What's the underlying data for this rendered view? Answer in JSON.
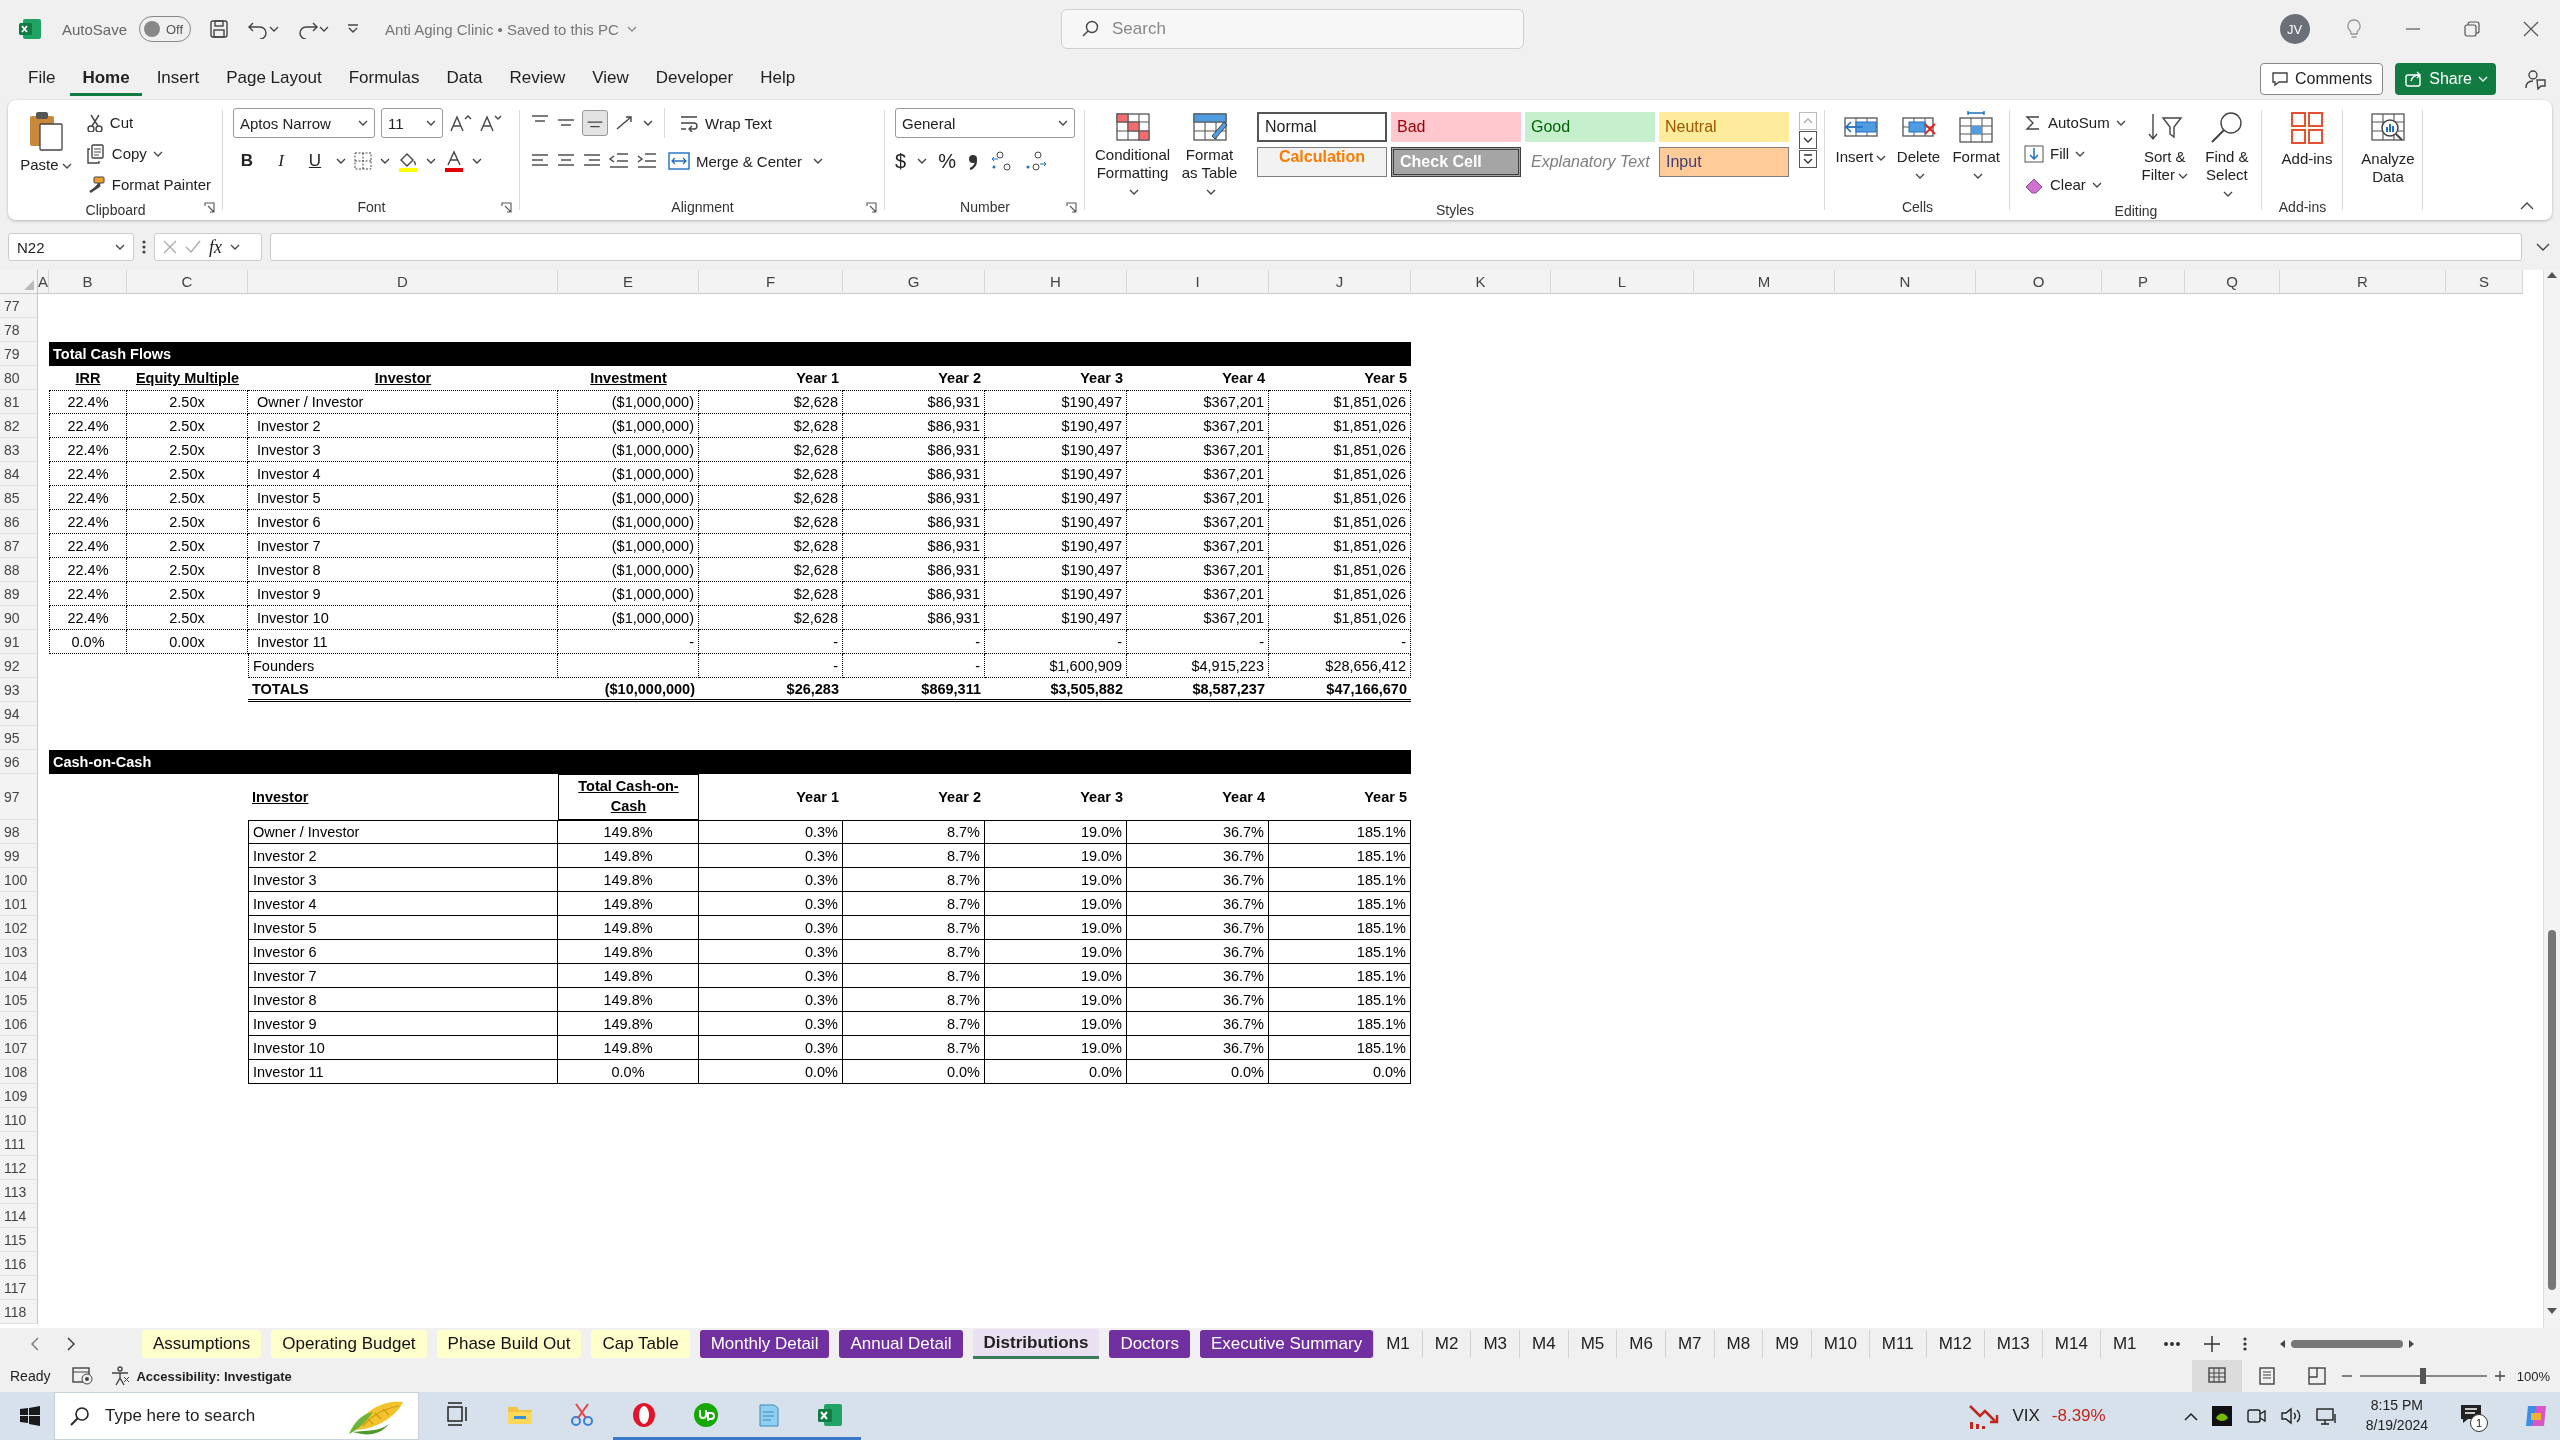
{
  "title_bar": {
    "autosave_label": "AutoSave",
    "autosave": {
      "on": false,
      "label": "Off"
    },
    "document_title": "Anti Aging Clinic • Saved to this PC",
    "search_placeholder": "Search",
    "avatar": "JV"
  },
  "menu": [
    {
      "label": "File",
      "selected": false
    },
    {
      "label": "Home",
      "selected": true
    },
    {
      "label": "Insert",
      "selected": false
    },
    {
      "label": "Page Layout",
      "selected": false
    },
    {
      "label": "Formulas",
      "selected": false
    },
    {
      "label": "Data",
      "selected": false
    },
    {
      "label": "Review",
      "selected": false
    },
    {
      "label": "View",
      "selected": false
    },
    {
      "label": "Developer",
      "selected": false
    },
    {
      "label": "Help",
      "selected": false
    }
  ],
  "comments_button": "Comments",
  "share_button": "Share",
  "ribbon": [
    {
      "kind": "clipboard",
      "label": "Clipboard",
      "paste": "Paste",
      "commands": [
        "Cut",
        "Copy",
        "Format Painter"
      ]
    },
    {
      "kind": "font",
      "label": "Font",
      "font": "Aptos Narrow",
      "size": "11",
      "styles": [
        "B",
        "I",
        "U"
      ]
    },
    {
      "kind": "alignment",
      "label": "Alignment",
      "commands": [
        "Wrap Text",
        "Merge & Center"
      ]
    },
    {
      "kind": "number",
      "label": "Number",
      "format": "General",
      "symbols": [
        "$",
        "%"
      ]
    },
    {
      "kind": "styles",
      "label": "Styles",
      "commands": [
        "Conditional Formatting",
        "Format as Table"
      ],
      "gallery": [
        {
          "label": "Normal",
          "kind": "normal"
        },
        {
          "label": "Bad",
          "kind": "bad"
        },
        {
          "label": "Good",
          "kind": "good"
        },
        {
          "label": "Neutral",
          "kind": "neutral"
        },
        {
          "label": "Calculation",
          "kind": "calculation"
        },
        {
          "label": "Check Cell",
          "kind": "check"
        },
        {
          "label": "Explanatory Text",
          "kind": "explanatory"
        },
        {
          "label": "Input",
          "kind": "input"
        }
      ]
    },
    {
      "kind": "cells",
      "label": "Cells",
      "commands": [
        "Insert",
        "Delete",
        "Format"
      ]
    },
    {
      "kind": "editing",
      "label": "Editing",
      "commands": [
        "AutoSum",
        "Fill",
        "Clear"
      ],
      "large": [
        "Sort & Filter",
        "Find & Select"
      ]
    },
    {
      "kind": "addins",
      "label": "Add-ins",
      "commands": [
        "Add-ins"
      ]
    },
    {
      "kind": "analyze",
      "commands": [
        "Analyze Data"
      ]
    }
  ],
  "formula_bar": {
    "name_box": "N22",
    "fx": "fx"
  },
  "sheet": {
    "columns": [
      "A",
      "B",
      "C",
      "D",
      "E",
      "F",
      "G",
      "H",
      "I",
      "J",
      "K",
      "L",
      "M",
      "N",
      "O",
      "P",
      "Q",
      "R",
      "S"
    ],
    "rows": [
      {
        "number": "77",
        "kind": "empty"
      },
      {
        "number": "78",
        "kind": "empty"
      },
      {
        "number": "79",
        "kind": "banner",
        "cells": {
          "B": "Total Cash Flows"
        }
      },
      {
        "number": "80",
        "kind": "header",
        "cells": {
          "B": {
            "text": "IRR",
            "underlined": true
          },
          "C": {
            "text": "Equity Multiple",
            "underlined": true
          },
          "D": {
            "text": "Investor",
            "underlined": true
          },
          "E": {
            "text": "Investment",
            "underlined": true
          },
          "F": {
            "text": "Year 1",
            "underlined": false
          },
          "G": {
            "text": "Year 2",
            "underlined": false
          },
          "H": {
            "text": "Year 3",
            "underlined": false
          },
          "I": {
            "text": "Year 4",
            "underlined": false
          },
          "J": {
            "text": "Year 5",
            "underlined": false
          }
        }
      },
      {
        "number": "81",
        "kind": "data",
        "cells": {
          "B": "22.4%",
          "C": "2.50x",
          "D": "Owner / Investor",
          "E": "($1,000,000)",
          "F": "$2,628",
          "G": "$86,931",
          "H": "$190,497",
          "I": "$367,201",
          "J": "$1,851,026"
        }
      },
      {
        "number": "82",
        "kind": "data",
        "cells": {
          "B": "22.4%",
          "C": "2.50x",
          "D": "Investor 2",
          "E": "($1,000,000)",
          "F": "$2,628",
          "G": "$86,931",
          "H": "$190,497",
          "I": "$367,201",
          "J": "$1,851,026"
        }
      },
      {
        "number": "83",
        "kind": "data",
        "cells": {
          "B": "22.4%",
          "C": "2.50x",
          "D": "Investor 3",
          "E": "($1,000,000)",
          "F": "$2,628",
          "G": "$86,931",
          "H": "$190,497",
          "I": "$367,201",
          "J": "$1,851,026"
        }
      },
      {
        "number": "84",
        "kind": "data",
        "cells": {
          "B": "22.4%",
          "C": "2.50x",
          "D": "Investor 4",
          "E": "($1,000,000)",
          "F": "$2,628",
          "G": "$86,931",
          "H": "$190,497",
          "I": "$367,201",
          "J": "$1,851,026"
        }
      },
      {
        "number": "85",
        "kind": "data",
        "cells": {
          "B": "22.4%",
          "C": "2.50x",
          "D": "Investor 5",
          "E": "($1,000,000)",
          "F": "$2,628",
          "G": "$86,931",
          "H": "$190,497",
          "I": "$367,201",
          "J": "$1,851,026"
        }
      },
      {
        "number": "86",
        "kind": "data",
        "cells": {
          "B": "22.4%",
          "C": "2.50x",
          "D": "Investor 6",
          "E": "($1,000,000)",
          "F": "$2,628",
          "G": "$86,931",
          "H": "$190,497",
          "I": "$367,201",
          "J": "$1,851,026"
        }
      },
      {
        "number": "87",
        "kind": "data",
        "cells": {
          "B": "22.4%",
          "C": "2.50x",
          "D": "Investor 7",
          "E": "($1,000,000)",
          "F": "$2,628",
          "G": "$86,931",
          "H": "$190,497",
          "I": "$367,201",
          "J": "$1,851,026"
        }
      },
      {
        "number": "88",
        "kind": "data",
        "cells": {
          "B": "22.4%",
          "C": "2.50x",
          "D": "Investor 8",
          "E": "($1,000,000)",
          "F": "$2,628",
          "G": "$86,931",
          "H": "$190,497",
          "I": "$367,201",
          "J": "$1,851,026"
        }
      },
      {
        "number": "89",
        "kind": "data",
        "cells": {
          "B": "22.4%",
          "C": "2.50x",
          "D": "Investor 9",
          "E": "($1,000,000)",
          "F": "$2,628",
          "G": "$86,931",
          "H": "$190,497",
          "I": "$367,201",
          "J": "$1,851,026"
        }
      },
      {
        "number": "90",
        "kind": "data",
        "cells": {
          "B": "22.4%",
          "C": "2.50x",
          "D": "Investor 10",
          "E": "($1,000,000)",
          "F": "$2,628",
          "G": "$86,931",
          "H": "$190,497",
          "I": "$367,201",
          "J": "$1,851,026"
        }
      },
      {
        "number": "91",
        "kind": "data",
        "cells": {
          "B": "0.0%",
          "C": "0.00x",
          "D": "Investor 11",
          "E": "-",
          "F": "-",
          "G": "-",
          "H": "-",
          "I": "-",
          "J": "-"
        }
      },
      {
        "number": "92",
        "kind": "subtotal",
        "cells": {
          "D": "Founders",
          "F": "-",
          "G": "-",
          "H": "$1,600,909",
          "I": "$4,915,223",
          "J": "$28,656,412"
        }
      },
      {
        "number": "93",
        "kind": "total",
        "cells": {
          "D": "TOTALS",
          "E": "($10,000,000)",
          "F": "$26,283",
          "G": "$869,311",
          "H": "$3,505,882",
          "I": "$8,587,237",
          "J": "$47,166,670"
        }
      },
      {
        "number": "94",
        "kind": "empty"
      },
      {
        "number": "95",
        "kind": "empty"
      },
      {
        "number": "96",
        "kind": "banner",
        "cells": {
          "B": "Cash-on-Cash"
        }
      },
      {
        "number": "97",
        "kind": "header-wrap",
        "cells": {
          "D": {
            "text": "Investor",
            "underlined": true
          },
          "E": {
            "text": "Total Cash-on-Cash",
            "underlined": true
          },
          "F": {
            "text": "Year 1",
            "underlined": false
          },
          "G": {
            "text": "Year 2",
            "underlined": false
          },
          "H": {
            "text": "Year 3",
            "underlined": false
          },
          "I": {
            "text": "Year 4",
            "underlined": false
          },
          "J": {
            "text": "Year 5",
            "underlined": false
          }
        }
      },
      {
        "number": "98",
        "kind": "ratio",
        "cells": {
          "D": "Owner / Investor",
          "E": "149.8%",
          "F": "0.3%",
          "G": "8.7%",
          "H": "19.0%",
          "I": "36.7%",
          "J": "185.1%"
        }
      },
      {
        "number": "99",
        "kind": "ratio",
        "cells": {
          "D": "Investor 2",
          "E": "149.8%",
          "F": "0.3%",
          "G": "8.7%",
          "H": "19.0%",
          "I": "36.7%",
          "J": "185.1%"
        }
      },
      {
        "number": "100",
        "kind": "ratio",
        "cells": {
          "D": "Investor 3",
          "E": "149.8%",
          "F": "0.3%",
          "G": "8.7%",
          "H": "19.0%",
          "I": "36.7%",
          "J": "185.1%"
        }
      },
      {
        "number": "101",
        "kind": "ratio",
        "cells": {
          "D": "Investor 4",
          "E": "149.8%",
          "F": "0.3%",
          "G": "8.7%",
          "H": "19.0%",
          "I": "36.7%",
          "J": "185.1%"
        }
      },
      {
        "number": "102",
        "kind": "ratio",
        "cells": {
          "D": "Investor 5",
          "E": "149.8%",
          "F": "0.3%",
          "G": "8.7%",
          "H": "19.0%",
          "I": "36.7%",
          "J": "185.1%"
        }
      },
      {
        "number": "103",
        "kind": "ratio",
        "cells": {
          "D": "Investor 6",
          "E": "149.8%",
          "F": "0.3%",
          "G": "8.7%",
          "H": "19.0%",
          "I": "36.7%",
          "J": "185.1%"
        }
      },
      {
        "number": "104",
        "kind": "ratio",
        "cells": {
          "D": "Investor 7",
          "E": "149.8%",
          "F": "0.3%",
          "G": "8.7%",
          "H": "19.0%",
          "I": "36.7%",
          "J": "185.1%"
        }
      },
      {
        "number": "105",
        "kind": "ratio",
        "cells": {
          "D": "Investor 8",
          "E": "149.8%",
          "F": "0.3%",
          "G": "8.7%",
          "H": "19.0%",
          "I": "36.7%",
          "J": "185.1%"
        }
      },
      {
        "number": "106",
        "kind": "ratio",
        "cells": {
          "D": "Investor 9",
          "E": "149.8%",
          "F": "0.3%",
          "G": "8.7%",
          "H": "19.0%",
          "I": "36.7%",
          "J": "185.1%"
        }
      },
      {
        "number": "107",
        "kind": "ratio",
        "cells": {
          "D": "Investor 10",
          "E": "149.8%",
          "F": "0.3%",
          "G": "8.7%",
          "H": "19.0%",
          "I": "36.7%",
          "J": "185.1%"
        }
      },
      {
        "number": "108",
        "kind": "ratio",
        "cells": {
          "D": "Investor 11",
          "E": "0.0%",
          "F": "0.0%",
          "G": "0.0%",
          "H": "0.0%",
          "I": "0.0%",
          "J": "0.0%"
        }
      },
      {
        "number": "109",
        "kind": "empty"
      },
      {
        "number": "110",
        "kind": "empty"
      },
      {
        "number": "111",
        "kind": "empty"
      },
      {
        "number": "112",
        "kind": "empty"
      },
      {
        "number": "113",
        "kind": "empty"
      },
      {
        "number": "114",
        "kind": "empty"
      },
      {
        "number": "115",
        "kind": "empty"
      },
      {
        "number": "116",
        "kind": "empty"
      },
      {
        "number": "117",
        "kind": "empty"
      },
      {
        "number": "118",
        "kind": "empty"
      }
    ]
  },
  "sheet_tabs": [
    {
      "label": "Assumptions",
      "selected": false,
      "color": "#ffffcc"
    },
    {
      "label": "Operating Budget",
      "selected": false,
      "color": "#ffffcc"
    },
    {
      "label": "Phase Build Out",
      "selected": false,
      "color": "#ffffcc"
    },
    {
      "label": "Cap Table",
      "selected": false,
      "color": "#ffffcc"
    },
    {
      "label": "Monthly Detail",
      "selected": false,
      "color": "#7030a0"
    },
    {
      "label": "Annual Detail",
      "selected": false,
      "color": "#7030a0"
    },
    {
      "label": "Distributions",
      "selected": true
    },
    {
      "label": "Doctors",
      "selected": false,
      "color": "#7030a0"
    },
    {
      "label": "Executive Summary",
      "selected": false,
      "color": "#7030a0"
    },
    {
      "label": "M1",
      "selected": false
    },
    {
      "label": "M2",
      "selected": false
    },
    {
      "label": "M3",
      "selected": false
    },
    {
      "label": "M4",
      "selected": false
    },
    {
      "label": "M5",
      "selected": false
    },
    {
      "label": "M6",
      "selected": false
    },
    {
      "label": "M7",
      "selected": false
    },
    {
      "label": "M8",
      "selected": false
    },
    {
      "label": "M9",
      "selected": false
    },
    {
      "label": "M10",
      "selected": false
    },
    {
      "label": "M11",
      "selected": false
    },
    {
      "label": "M12",
      "selected": false
    },
    {
      "label": "M13",
      "selected": false
    },
    {
      "label": "M14",
      "selected": false
    },
    {
      "label": "M1",
      "selected": false
    }
  ],
  "status_bar": {
    "ready": "Ready",
    "accessibility": "Accessibility: Investigate",
    "view_buttons": [
      {
        "selected": true
      },
      {
        "selected": false
      },
      {
        "selected": false
      }
    ],
    "zoom_slider": {
      "level": 0.5
    },
    "zoom": "100%"
  },
  "taskbar": {
    "search_placeholder": "Type here to search",
    "apps": [
      {
        "running": false
      },
      {
        "running": false
      },
      {
        "running": false
      },
      {
        "running": true
      },
      {
        "running": true
      },
      {
        "running": true
      },
      {
        "running": true
      }
    ],
    "ticker": "VIX",
    "change": "-8.39%",
    "time": "8:15 PM",
    "date": "8/19/2024",
    "notifications": "1"
  }
}
